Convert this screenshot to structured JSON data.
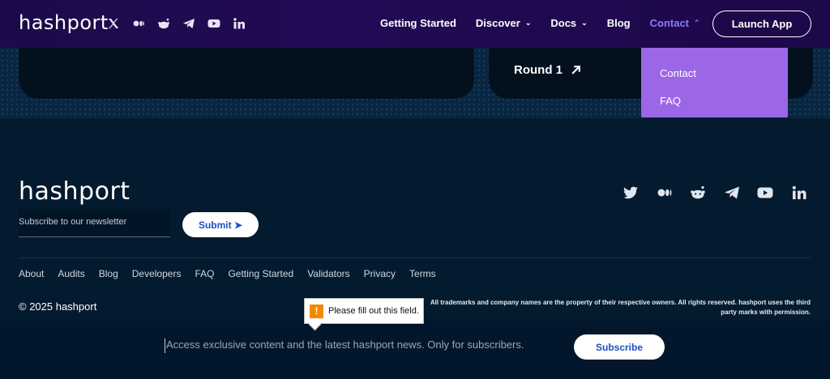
{
  "nav": {
    "logo": "hashport",
    "social_icons": [
      "x-icon",
      "medium-icon",
      "reddit-icon",
      "telegram-icon",
      "youtube-icon",
      "linkedin-icon"
    ],
    "links": [
      {
        "label": "Getting Started",
        "chevron": ""
      },
      {
        "label": "Discover",
        "chevron": "⌄"
      },
      {
        "label": "Docs",
        "chevron": "⌄"
      },
      {
        "label": "Blog",
        "chevron": ""
      },
      {
        "label": "Contact",
        "chevron": "⌃"
      }
    ],
    "launch_label": "Launch App"
  },
  "dropdown": {
    "items": [
      "Contact",
      "FAQ"
    ]
  },
  "hero": {
    "round_label": "Round 1"
  },
  "footer": {
    "logo": "hashport",
    "social_icons": [
      "twitter-icon",
      "medium-icon",
      "reddit-icon",
      "telegram-icon",
      "youtube-icon",
      "linkedin-icon"
    ],
    "newsletter_placeholder": "Subscribe to our newsletter",
    "subscribe_label": "Submit ➤",
    "links": [
      "About",
      "Audits",
      "Blog",
      "Developers",
      "FAQ",
      "Getting Started",
      "Validators",
      "Privacy",
      "Terms"
    ],
    "copyright": "© 2025 hashport",
    "legal": "All trademarks and company names are the property of their respective owners. All rights reserved. hashport uses the third party marks with permission."
  },
  "tooltip": {
    "icon": "!",
    "text": "Please fill out this field."
  },
  "bottom_bar": {
    "placeholder": "Access exclusive content and the latest hashport news. Only for subscribers.",
    "subscribe_label": "Subscribe"
  },
  "colors": {
    "nav_bg": "#1c0a4a",
    "accent_purple": "#8e7bff",
    "dropdown_bg": "#9b67e6",
    "page_bg": "#041a2e",
    "button_text_blue": "#1e4fc2",
    "warning_orange": "#f08a00"
  }
}
